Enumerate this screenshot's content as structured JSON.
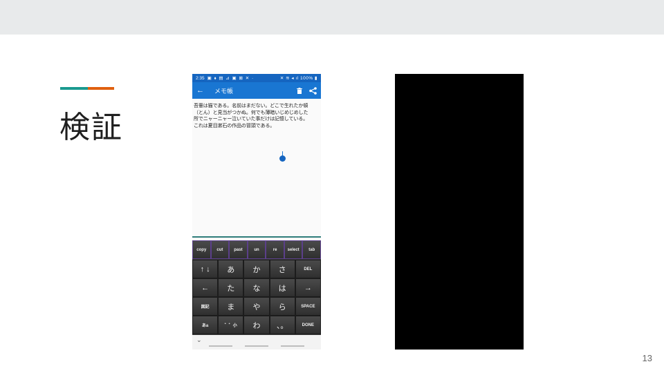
{
  "slide": {
    "title": "検証",
    "page_number": "13",
    "colors": {
      "band": "#e8eaeb",
      "accent_teal": "#1a9a8f",
      "accent_orange": "#e0600f"
    }
  },
  "phone": {
    "status": {
      "time": "2:35",
      "icons": "▣ ⬧ ▤ ⊿ ▣ ⊠ ✕ ·",
      "right": "✕ ≋ ◂ ıl 100% ▮"
    },
    "appbar": {
      "back_icon": "arrow-back-icon",
      "title": "メモ帳",
      "delete_icon": "trash-icon",
      "share_icon": "share-icon"
    },
    "note": {
      "text": "吾輩は猫である。名前はまだない。どこで生れたか頓\n（とん）と見当がつかぬ。何でも薄暗いじめじめした\n所でニャーニャー泣いていた事だけは記憶している。\nこれは夏目漱石の作品の冒頭である。"
    },
    "keyboard": {
      "function_row": [
        "copy",
        "cut",
        "past",
        "un",
        "re",
        "select",
        "tab"
      ],
      "rows": [
        [
          "↑ ↓",
          "あ",
          "か",
          "さ",
          "DEL"
        ],
        [
          "←",
          "た",
          "な",
          "は",
          "→"
        ],
        [
          "図記",
          "ま",
          "や",
          "ら",
          "SPACE"
        ],
        [
          "あa",
          "゛゜小",
          "わ",
          "、。",
          "DONE"
        ]
      ]
    },
    "navbar": {
      "collapse_icon": "chevron-down-icon"
    }
  }
}
